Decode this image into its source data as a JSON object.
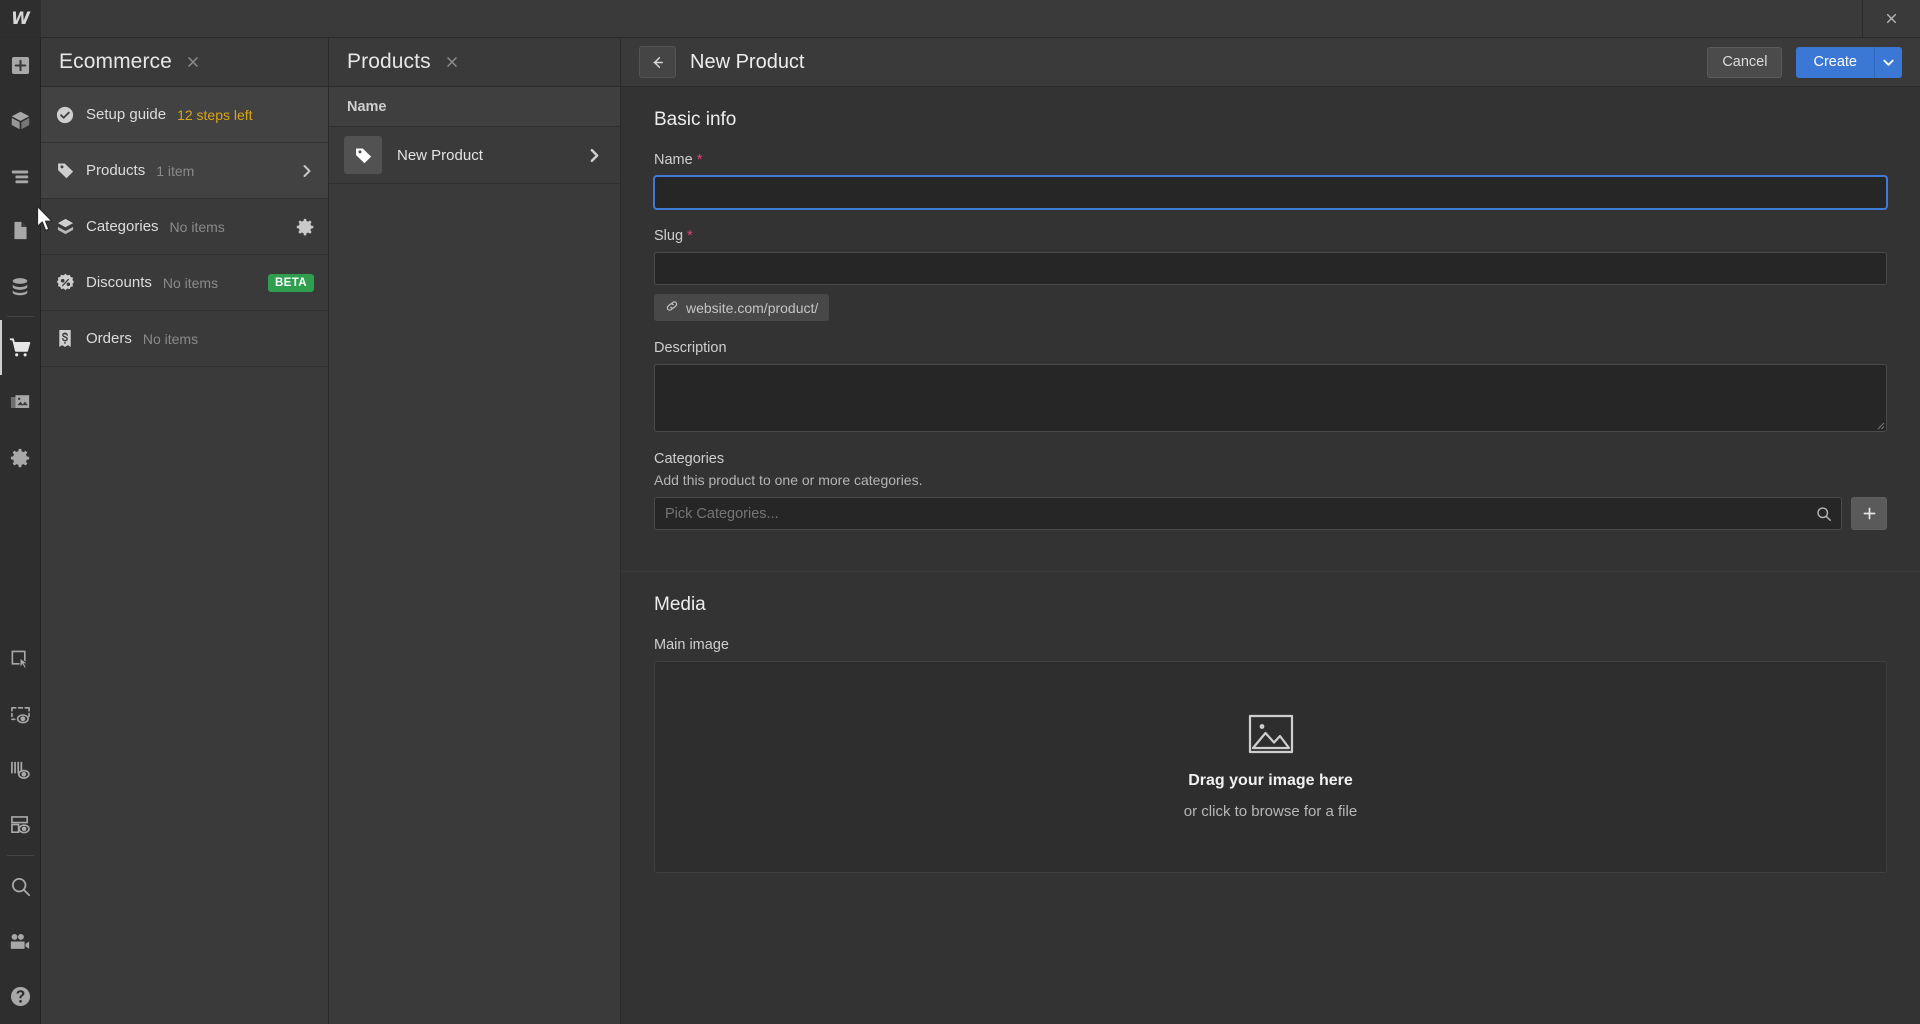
{
  "window": {
    "logo_text": "W",
    "close_icon": "close-icon"
  },
  "rail": {
    "items": [
      {
        "icon": "add-icon",
        "name": "add-elements"
      },
      {
        "icon": "components-cube-icon",
        "name": "components"
      },
      {
        "icon": "navigator-layers-icon",
        "name": "navigator"
      },
      {
        "icon": "pages-document-icon",
        "name": "pages"
      },
      {
        "icon": "cms-database-icon",
        "name": "cms"
      },
      {
        "icon": "ecommerce-cart-icon",
        "name": "ecommerce"
      },
      {
        "icon": "assets-images-icon",
        "name": "assets"
      },
      {
        "icon": "settings-gear-icon",
        "name": "settings"
      },
      {
        "icon": "selection-arrow-icon",
        "name": "selection-tool"
      },
      {
        "icon": "element-preview-icon",
        "name": "element-preview"
      },
      {
        "icon": "audit-bars-icon",
        "name": "audit"
      },
      {
        "icon": "layout-preview-icon",
        "name": "layout-preview"
      },
      {
        "icon": "search-icon",
        "name": "search"
      },
      {
        "icon": "video-tutorials-icon",
        "name": "video-tutorials"
      },
      {
        "icon": "help-question-icon",
        "name": "help"
      }
    ]
  },
  "ecommerce_panel": {
    "title": "Ecommerce",
    "close_icon": "close-icon",
    "rows": [
      {
        "icon": "check-circle-icon",
        "label": "Setup guide",
        "sub": "12 steps left",
        "sub_style": "warn",
        "trailing": "none"
      },
      {
        "icon": "tag-icon",
        "label": "Products",
        "sub": "1 item",
        "sub_style": "muted",
        "trailing": "chevron"
      },
      {
        "icon": "category-box-icon",
        "label": "Categories",
        "sub": "No items",
        "sub_style": "muted",
        "trailing": "gear"
      },
      {
        "icon": "discount-badge-icon",
        "label": "Discounts",
        "sub": "No items",
        "sub_style": "muted",
        "trailing": "beta",
        "badge": "BETA"
      },
      {
        "icon": "receipt-dollar-icon",
        "label": "Orders",
        "sub": "No items",
        "sub_style": "muted",
        "trailing": "none"
      }
    ]
  },
  "products_panel": {
    "title": "Products",
    "close_icon": "close-icon",
    "column_header": "Name",
    "rows": [
      {
        "icon": "tag-icon",
        "name": "New Product"
      }
    ]
  },
  "editor": {
    "back_icon": "arrow-left-icon",
    "title": "New Product",
    "cancel_label": "Cancel",
    "create_label": "Create",
    "create_caret_icon": "chevron-down-icon",
    "sections": {
      "basic_info": {
        "title": "Basic info",
        "name": {
          "label": "Name",
          "required": "*",
          "value": "",
          "placeholder": ""
        },
        "slug": {
          "label": "Slug",
          "required": "*",
          "value": "",
          "placeholder": "",
          "chip_icon": "link-icon",
          "chip_text": "website.com/product/"
        },
        "description": {
          "label": "Description",
          "value": "",
          "placeholder": ""
        },
        "categories": {
          "label": "Categories",
          "help": "Add this product to one or more categories.",
          "placeholder": "Pick Categories...",
          "value": "",
          "search_icon": "search-icon",
          "add_icon": "plus-icon"
        }
      },
      "media": {
        "title": "Media",
        "main_image": {
          "label": "Main image",
          "icon": "image-placeholder-icon",
          "drop_title": "Drag your image here",
          "drop_sub": "or click to browse for a file"
        }
      }
    }
  },
  "colors": {
    "accent_blue": "#3b77d4",
    "beta_green": "#2f9e4f",
    "required_red": "#e0436f",
    "warning_yellow": "#d9a514",
    "panel_bg": "#3a3a3a",
    "editor_bg": "#333333",
    "rail_bg": "#2e2e2e"
  }
}
